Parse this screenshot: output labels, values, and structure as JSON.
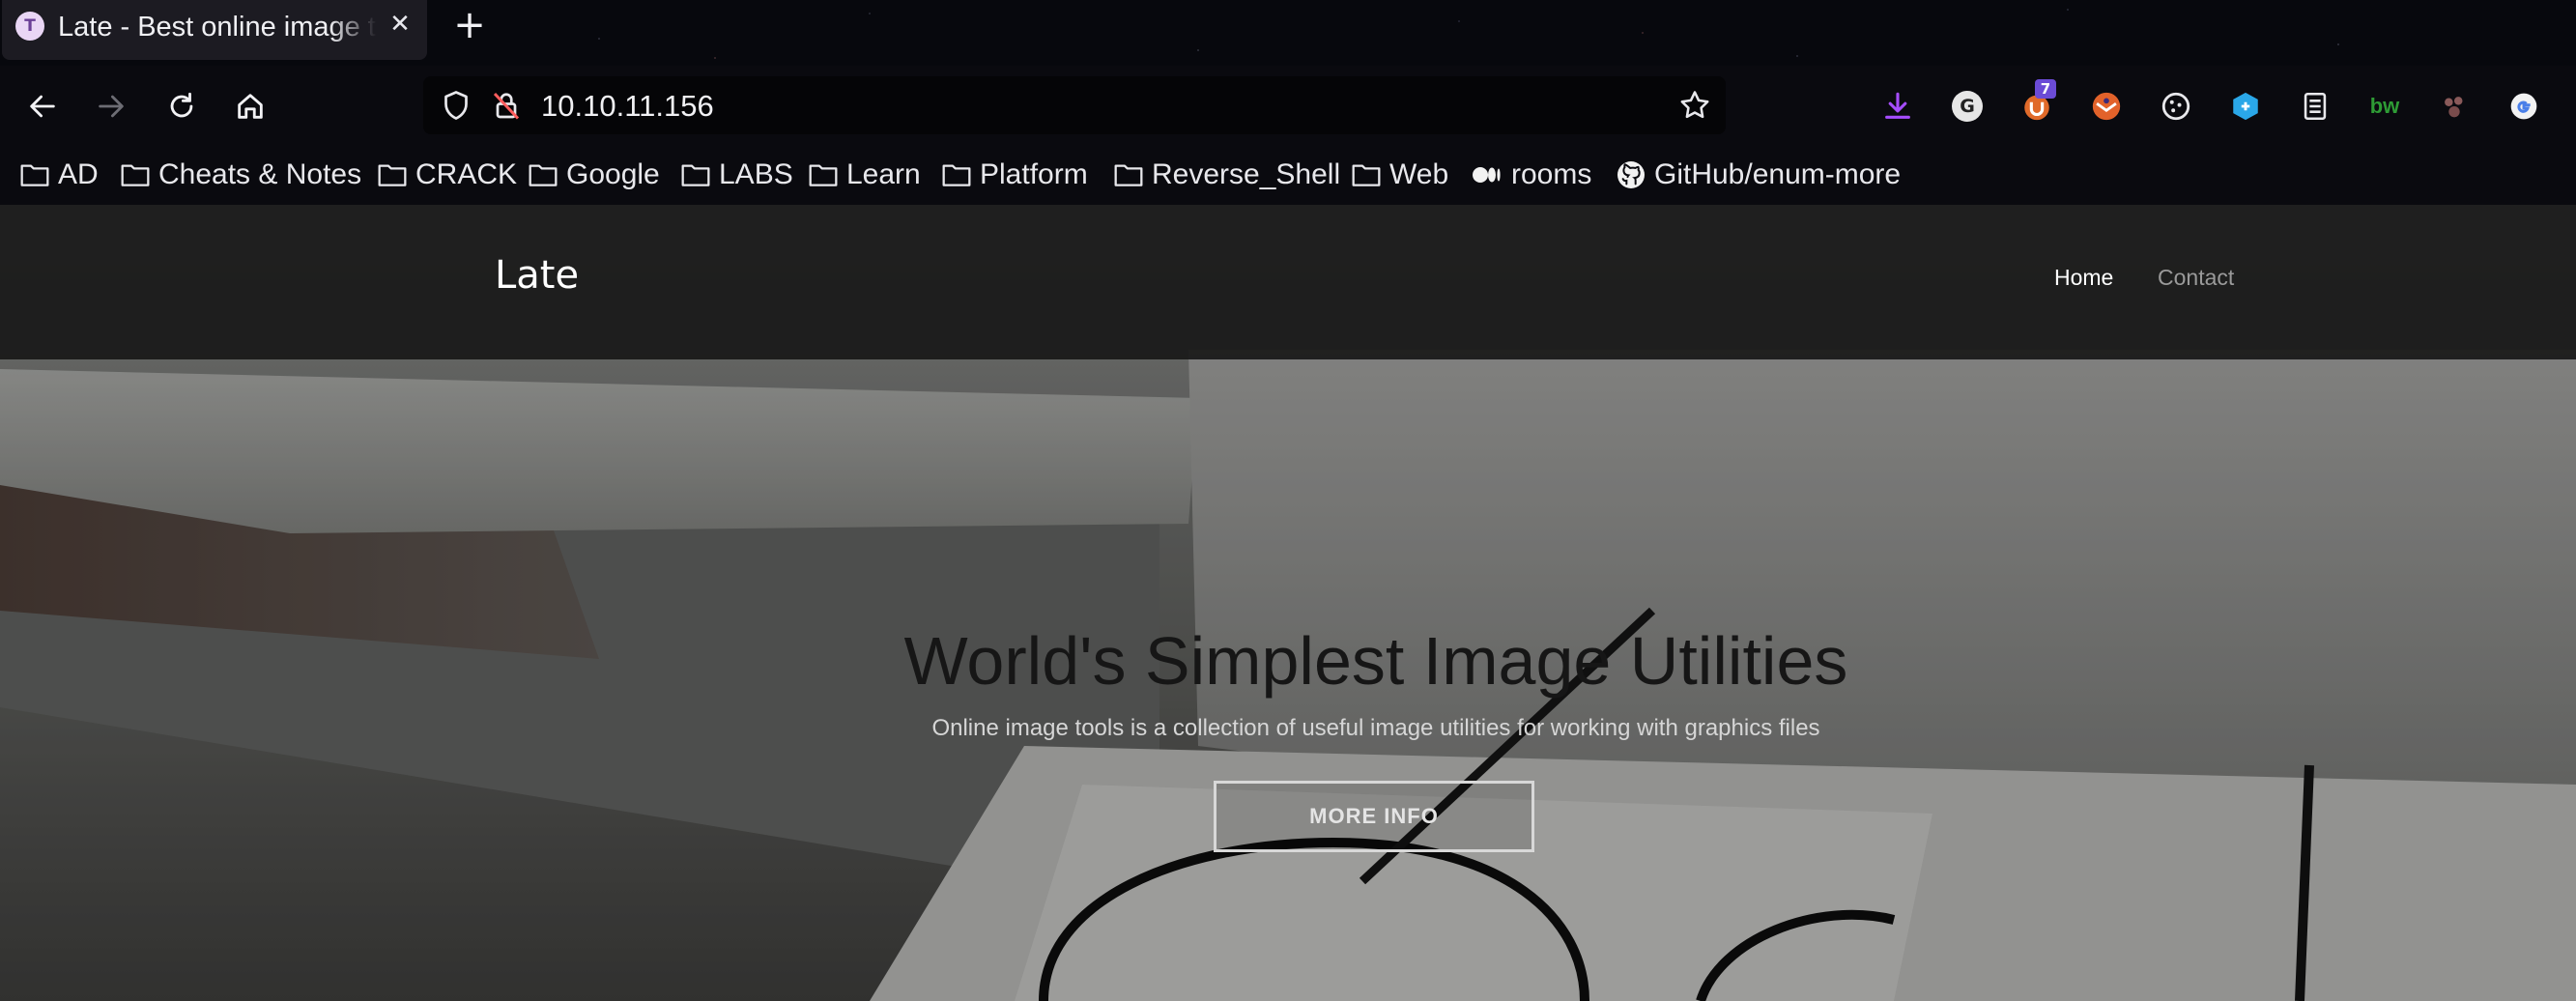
{
  "browser": {
    "tab": {
      "favicon_letter": "T",
      "title": "Late - Best online image tools",
      "close_glyph": "✕"
    },
    "new_tab_glyph": "+",
    "url": "10.10.11.156",
    "extensions": {
      "downloads_badge": "",
      "ublock_badge": "7",
      "bitwarden_label": "bw",
      "g_label": "G"
    },
    "bookmarks": [
      {
        "label": "AD",
        "icon": "folder-icon"
      },
      {
        "label": "Cheats & Notes",
        "icon": "folder-icon"
      },
      {
        "label": "CRACK",
        "icon": "folder-icon"
      },
      {
        "label": "Google",
        "icon": "folder-icon"
      },
      {
        "label": "LABS",
        "icon": "folder-icon"
      },
      {
        "label": "Learn",
        "icon": "folder-icon"
      },
      {
        "label": "Platform",
        "icon": "folder-icon"
      },
      {
        "label": "Reverse_Shell",
        "icon": "folder-icon"
      },
      {
        "label": "Web",
        "icon": "folder-icon"
      },
      {
        "label": "rooms",
        "icon": "medium-icon"
      },
      {
        "label": "GitHub/enum-more",
        "icon": "github-icon"
      }
    ]
  },
  "site": {
    "logo": "Late",
    "nav": {
      "home": "Home",
      "contact": "Contact"
    },
    "hero": {
      "title": "World's Simplest Image Utilities",
      "subtitle": "Online image tools is a collection of useful image utilities for working with graphics files",
      "button": "MORE INFO"
    }
  }
}
